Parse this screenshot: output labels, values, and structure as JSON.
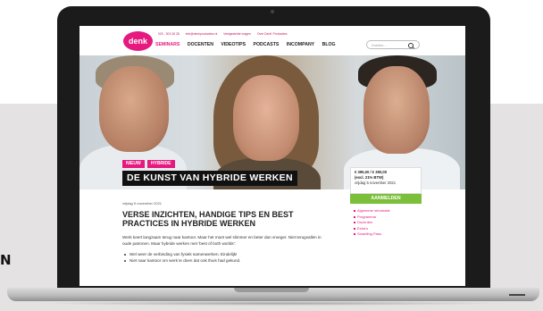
{
  "side_text": "N",
  "site": {
    "topline": [
      "020 - 303 28 28",
      "info@denkproducties.nl",
      "Veelgestelde vragen",
      "Over DenK Producties"
    ],
    "logo": "denk",
    "nav": [
      "SEMINARS",
      "DOCENTEN",
      "VIDEOTIPS",
      "PODCASTS",
      "INCOMPANY",
      "BLOG"
    ],
    "active_nav": "SEMINARS",
    "search_placeholder": "Zoeken...",
    "tags": [
      "NIEUW",
      "HYBRIDE"
    ],
    "hero_title": "DE KUNST VAN HYBRIDE WERKEN",
    "price_line1": "€ 395,00 / € 390,00",
    "price_line2": "(excl. 21% BTW)",
    "price_date": "vrijdag 5 november 2021",
    "cta": "AANMELDEN",
    "side_links": [
      "Algemene informatie",
      "Programma",
      "Docenten",
      "Extra's",
      "Smartling Pass"
    ],
    "date": "vrijdag 5 november 2021",
    "heading": "VERSE INZICHTEN, HANDIGE TIPS EN BEST PRACTICES IN HYBRIDE WERKEN",
    "paragraph": "Werk keert langzaam terug naar kantoor. Maar het moet wel slimmer en beter dan vroeger. Niet terugvallen in oude patronen. Maar hybride werken met 'best of both worlds':",
    "bullets": [
      "Wel weer de verbinding van fysiek samenwerken. Eindelijk!",
      "Niet naar kantoor om werk te doen dat ook thuis had gekund."
    ]
  },
  "colors": {
    "brand_pink": "#e5197f",
    "cta_green": "#7cbf3a",
    "lid": "#1b1b1b"
  }
}
